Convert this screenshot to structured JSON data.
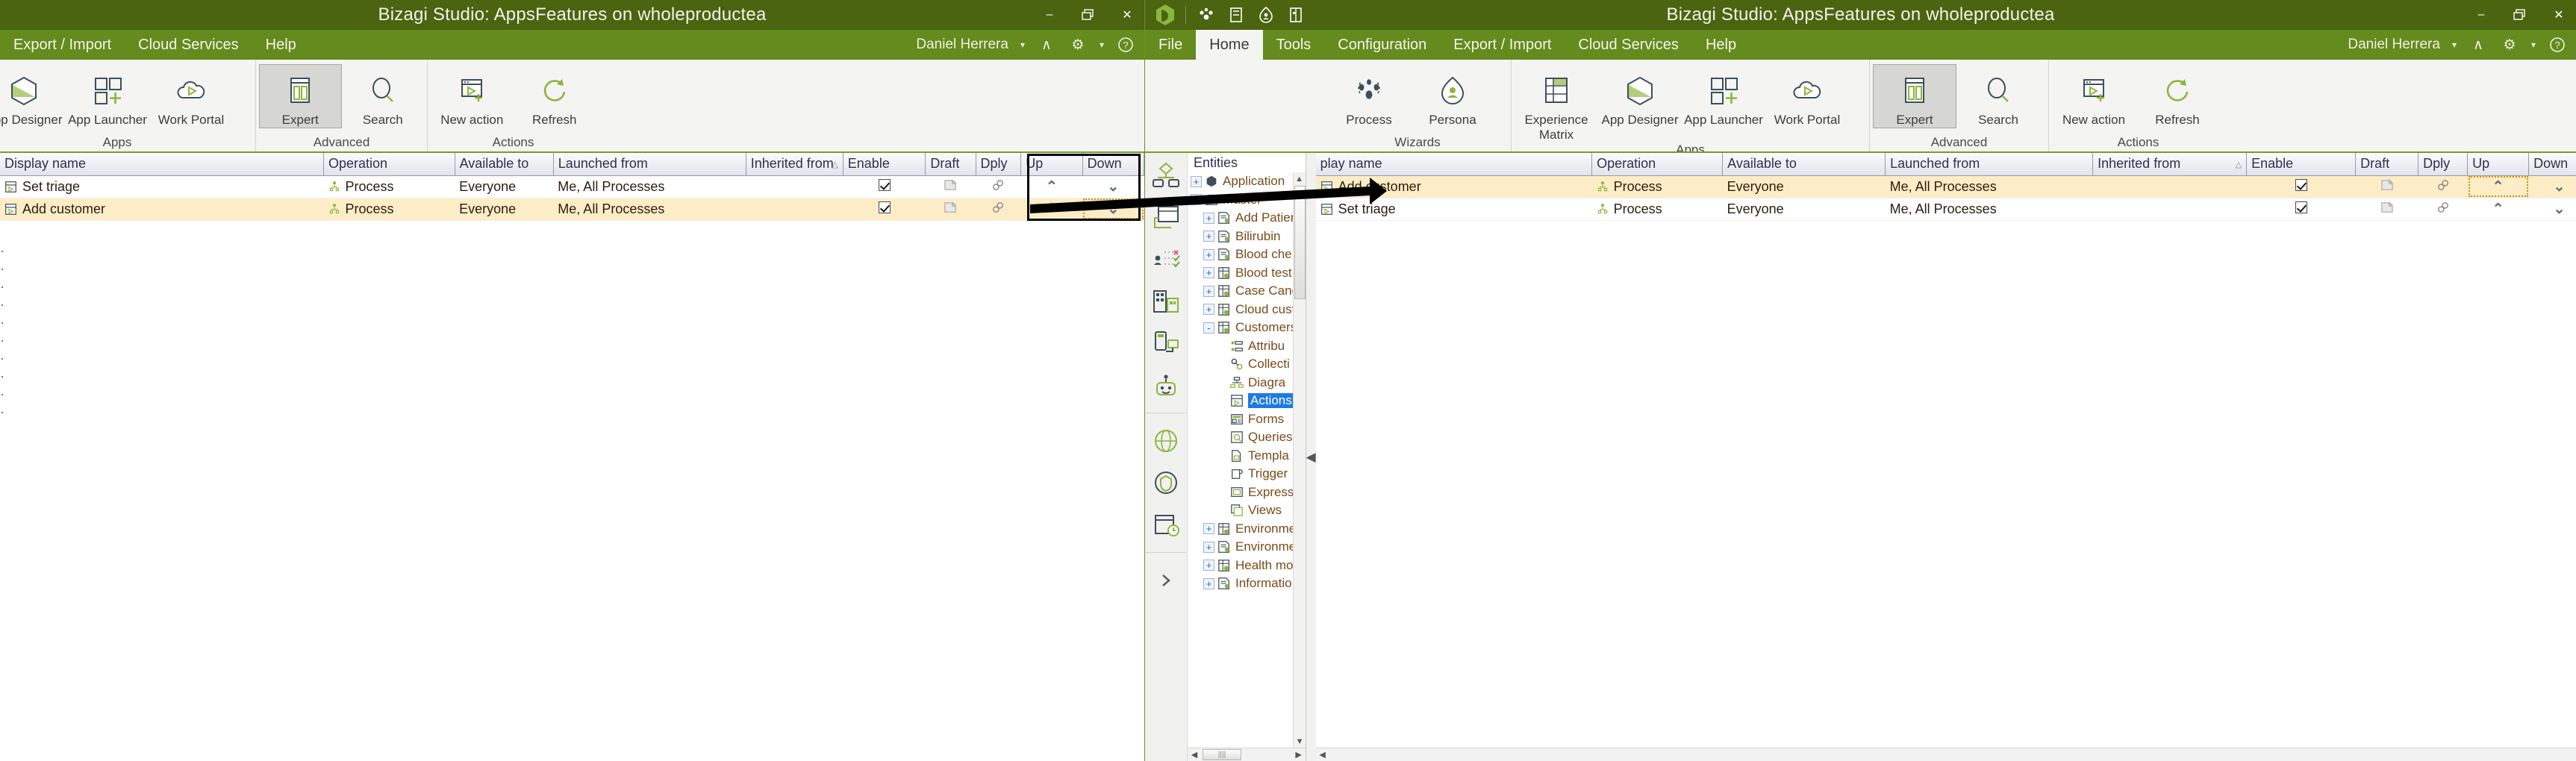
{
  "left_window": {
    "title": "Bizagi Studio: AppsFeatures  on  wholeproductea",
    "window_controls": {
      "minimize": "–",
      "restore": "❐",
      "close": "✕"
    },
    "menu": [
      {
        "label": "Export / Import"
      },
      {
        "label": "Cloud Services"
      },
      {
        "label": "Help"
      }
    ],
    "user": {
      "name": "Daniel Herrera",
      "caret": "▾",
      "collapse": "∧",
      "gear": "⚙",
      "gear_caret": "▾",
      "help": "?"
    },
    "ribbon_groups": [
      {
        "label": "Apps",
        "buttons": [
          {
            "label": "App Designer",
            "icon": "app-designer-icon",
            "selected": false
          },
          {
            "label": "App Launcher",
            "icon": "app-launcher-icon",
            "selected": false
          },
          {
            "label": "Work Portal",
            "icon": "work-portal-icon",
            "selected": false
          }
        ]
      },
      {
        "label": "Advanced",
        "buttons": [
          {
            "label": "Expert",
            "icon": "expert-icon",
            "selected": true
          },
          {
            "label": "Search",
            "icon": "search-icon",
            "selected": false
          }
        ]
      },
      {
        "label": "Actions",
        "buttons": [
          {
            "label": "New action",
            "icon": "new-action-icon",
            "selected": false
          },
          {
            "label": "Refresh",
            "icon": "refresh-icon",
            "selected": false
          }
        ]
      }
    ],
    "grid": {
      "columns": [
        {
          "key": "display_name",
          "label": "Display name"
        },
        {
          "key": "operation",
          "label": "Operation"
        },
        {
          "key": "available_to",
          "label": "Available to"
        },
        {
          "key": "launched_from",
          "label": "Launched from"
        },
        {
          "key": "inherited_from",
          "label": "Inherited from",
          "sort": "△"
        },
        {
          "key": "enable",
          "label": "Enable"
        },
        {
          "key": "draft",
          "label": "Draft"
        },
        {
          "key": "dply",
          "label": "Dply"
        },
        {
          "key": "up",
          "label": "Up"
        },
        {
          "key": "down",
          "label": "Down"
        }
      ],
      "rows": [
        {
          "display_name": "Set triage",
          "operation": "Process",
          "available_to": "Everyone",
          "launched_from": "Me, All Processes",
          "inherited_from": "",
          "enable": true,
          "highlighted": false,
          "focused_cell": ""
        },
        {
          "display_name": "Add customer",
          "operation": "Process",
          "available_to": "Everyone",
          "launched_from": "Me, All Processes",
          "inherited_from": "",
          "enable": true,
          "highlighted": true,
          "focused_cell": "down"
        }
      ],
      "up_glyph": "⌃",
      "down_glyph": "⌄"
    }
  },
  "right_window": {
    "title": "Bizagi Studio: AppsFeatures  on  wholeproductea",
    "window_controls": {
      "minimize": "–",
      "restore": "❐",
      "close": "✕"
    },
    "quick_access": [
      "bizagi-logo-icon",
      "process-icon",
      "form-icon",
      "persona-icon",
      "entity-icon"
    ],
    "tabs": [
      {
        "label": "File",
        "active": false,
        "file": true
      },
      {
        "label": "Home",
        "active": true
      },
      {
        "label": "Tools",
        "active": false
      },
      {
        "label": "Configuration",
        "active": false
      },
      {
        "label": "Export / Import",
        "active": false
      },
      {
        "label": "Cloud Services",
        "active": false
      },
      {
        "label": "Help",
        "active": false
      }
    ],
    "user": {
      "name": "Daniel Herrera",
      "caret": "▾",
      "collapse": "∧",
      "gear": "⚙",
      "gear_caret": "▾",
      "help": "?"
    },
    "ribbon_groups": [
      {
        "label": "Wizards",
        "buttons": [
          {
            "label": "Process",
            "icon": "process-wizard-icon",
            "selected": false
          },
          {
            "label": "Persona",
            "icon": "persona-icon",
            "selected": false
          }
        ]
      },
      {
        "label": "Apps",
        "buttons": [
          {
            "label": "Experience Matrix",
            "icon": "experience-matrix-icon",
            "selected": false,
            "wrap": true
          },
          {
            "label": "App Designer",
            "icon": "app-designer-icon",
            "selected": false
          },
          {
            "label": "App Launcher",
            "icon": "app-launcher-icon",
            "selected": false
          },
          {
            "label": "Work Portal",
            "icon": "work-portal-icon",
            "selected": false
          }
        ]
      },
      {
        "label": "Advanced",
        "buttons": [
          {
            "label": "Expert",
            "icon": "expert-icon",
            "selected": true
          },
          {
            "label": "Search",
            "icon": "search-icon",
            "selected": false
          }
        ]
      },
      {
        "label": "Actions",
        "buttons": [
          {
            "label": "New action",
            "icon": "new-action-icon",
            "selected": false
          },
          {
            "label": "Refresh",
            "icon": "refresh-icon",
            "selected": false
          }
        ]
      }
    ],
    "tree": {
      "header": "Entities",
      "nodes": [
        {
          "label": "Application",
          "depth": 0,
          "expander": "+",
          "icon": "application-icon"
        },
        {
          "label": "Master",
          "depth": 0,
          "expander": "-",
          "icon": "master-folder-icon"
        },
        {
          "label": "Add Patien",
          "depth": 1,
          "expander": "+",
          "icon": "parameter-entity-icon"
        },
        {
          "label": "Bilirubin",
          "depth": 1,
          "expander": "+",
          "icon": "parameter-entity-icon"
        },
        {
          "label": "Blood che",
          "depth": 1,
          "expander": "+",
          "icon": "parameter-entity-icon"
        },
        {
          "label": "Blood test",
          "depth": 1,
          "expander": "+",
          "icon": "master-entity-icon"
        },
        {
          "label": "Case Cance",
          "depth": 1,
          "expander": "+",
          "icon": "master-entity-icon"
        },
        {
          "label": "Cloud cust",
          "depth": 1,
          "expander": "+",
          "icon": "master-entity-icon"
        },
        {
          "label": "Customers",
          "depth": 1,
          "expander": "-",
          "icon": "master-entity-icon"
        },
        {
          "label": "Attribu",
          "depth": 2,
          "expander": "",
          "icon": "attributes-icon"
        },
        {
          "label": "Collecti",
          "depth": 2,
          "expander": "",
          "icon": "collections-icon"
        },
        {
          "label": "Diagra",
          "depth": 2,
          "expander": "",
          "icon": "diagram-icon"
        },
        {
          "label": "Actions",
          "depth": 2,
          "expander": "",
          "icon": "actions-icon",
          "selected": true
        },
        {
          "label": "Forms",
          "depth": 2,
          "expander": "",
          "icon": "forms-icon"
        },
        {
          "label": "Queries",
          "depth": 2,
          "expander": "",
          "icon": "queries-icon"
        },
        {
          "label": "Templa",
          "depth": 2,
          "expander": "",
          "icon": "templates-icon"
        },
        {
          "label": "Trigger",
          "depth": 2,
          "expander": "",
          "icon": "triggers-icon"
        },
        {
          "label": "Express",
          "depth": 2,
          "expander": "",
          "icon": "expressions-icon"
        },
        {
          "label": "Views",
          "depth": 2,
          "expander": "",
          "icon": "views-icon"
        },
        {
          "label": "Environme",
          "depth": 1,
          "expander": "+",
          "icon": "master-entity-icon"
        },
        {
          "label": "Environme",
          "depth": 1,
          "expander": "+",
          "icon": "parameter-entity-icon"
        },
        {
          "label": "Health mo",
          "depth": 1,
          "expander": "+",
          "icon": "master-entity-icon"
        },
        {
          "label": "Informatio",
          "depth": 1,
          "expander": "+",
          "icon": "parameter-entity-icon"
        }
      ]
    },
    "grid": {
      "columns": [
        {
          "key": "display_name",
          "label": "play name"
        },
        {
          "key": "operation",
          "label": "Operation"
        },
        {
          "key": "available_to",
          "label": "Available to"
        },
        {
          "key": "launched_from",
          "label": "Launched from"
        },
        {
          "key": "inherited_from",
          "label": "Inherited from",
          "sort": "△"
        },
        {
          "key": "enable",
          "label": "Enable"
        },
        {
          "key": "draft",
          "label": "Draft"
        },
        {
          "key": "dply",
          "label": "Dply"
        },
        {
          "key": "up",
          "label": "Up"
        },
        {
          "key": "down",
          "label": "Down"
        }
      ],
      "rows": [
        {
          "display_name": "Add customer",
          "operation": "Process",
          "available_to": "Everyone",
          "launched_from": "Me, All Processes",
          "inherited_from": "",
          "enable": true,
          "highlighted": true,
          "focused_cell": "up"
        },
        {
          "display_name": "Set triage",
          "operation": "Process",
          "available_to": "Everyone",
          "launched_from": "Me, All Processes",
          "inherited_from": "",
          "enable": true,
          "highlighted": false,
          "focused_cell": ""
        }
      ],
      "up_glyph": "⌃",
      "down_glyph": "⌄"
    }
  },
  "annotation": {
    "kind": "pointer-arrow",
    "description": "black arrow from Up/Down highlight box in left window to the right window grid row"
  },
  "colors": {
    "titlebar": "#4a6410",
    "menubar": "#658a1e",
    "ribbon_bg": "#f4f4f2",
    "ribbon_rule": "#7d9a2b",
    "row_highlight": "#fdedc7",
    "tree_selection": "#1e7ae0",
    "focus_outline": "#d98b00",
    "accent_green": "#8cb63c",
    "icon_outline": "#3d4f5c"
  }
}
